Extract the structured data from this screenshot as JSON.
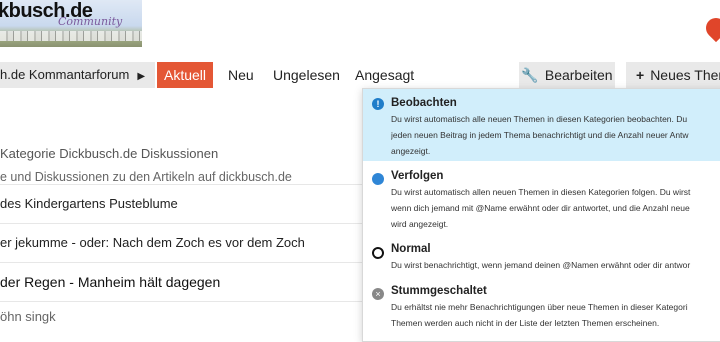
{
  "header": {
    "logo_text": "kbusch.de",
    "logo_sub": "Community",
    "icon": "map-marker-icon"
  },
  "topbar": {
    "breadcrumb": "h.de Kommantarforum",
    "nav": [
      "Aktuell",
      "Neu",
      "Ungelesen",
      "Angesagt"
    ],
    "edit_label": "Bearbeiten",
    "new_topic_label": "Neues Them",
    "accent_color": "#e45735"
  },
  "topics": [
    {
      "title": "Kategorie Dickbusch.de Diskussionen",
      "desc": "e und Diskussionen zu den Artikeln auf dickbusch.de"
    },
    {
      "title": "des Kindergartens Pusteblume"
    },
    {
      "title": "er jekumme - oder: Nach dem Zoch es vor dem Zoch"
    },
    {
      "title": "der Regen - Manheim hält dagegen"
    },
    {
      "title": "öhn singk"
    }
  ],
  "notification_menu": {
    "selected_bg": "#d1eefb",
    "options": [
      {
        "title": "Beobachten",
        "icon": "exclamation-circle-icon",
        "lines": [
          "Du wirst automatisch alle neuen Themen in diesen Kategorien beobachten. Du",
          "jeden neuen Beitrag in jedem Thema benachrichtigt und die Anzahl neuer Antw",
          "angezeigt."
        ]
      },
      {
        "title": "Verfolgen",
        "icon": "filled-circle-icon",
        "lines": [
          "Du wirst automatisch allen neuen Themen in diesen Kategorien folgen. Du wirst",
          "wenn dich jemand mit @Name erwähnt oder dir antwortet, und die Anzahl neue",
          "wird angezeigt."
        ]
      },
      {
        "title": "Normal",
        "icon": "empty-circle-icon",
        "lines": [
          "Du wirst benachrichtigt, wenn jemand deinen @Namen erwähnt oder dir antwor"
        ]
      },
      {
        "title": "Stummgeschaltet",
        "icon": "muted-circle-icon",
        "lines": [
          "Du erhältst nie mehr Benachrichtigungen über neue Themen in dieser Kategori",
          "Themen werden auch nicht in der Liste der letzten Themen erscheinen."
        ]
      }
    ]
  }
}
